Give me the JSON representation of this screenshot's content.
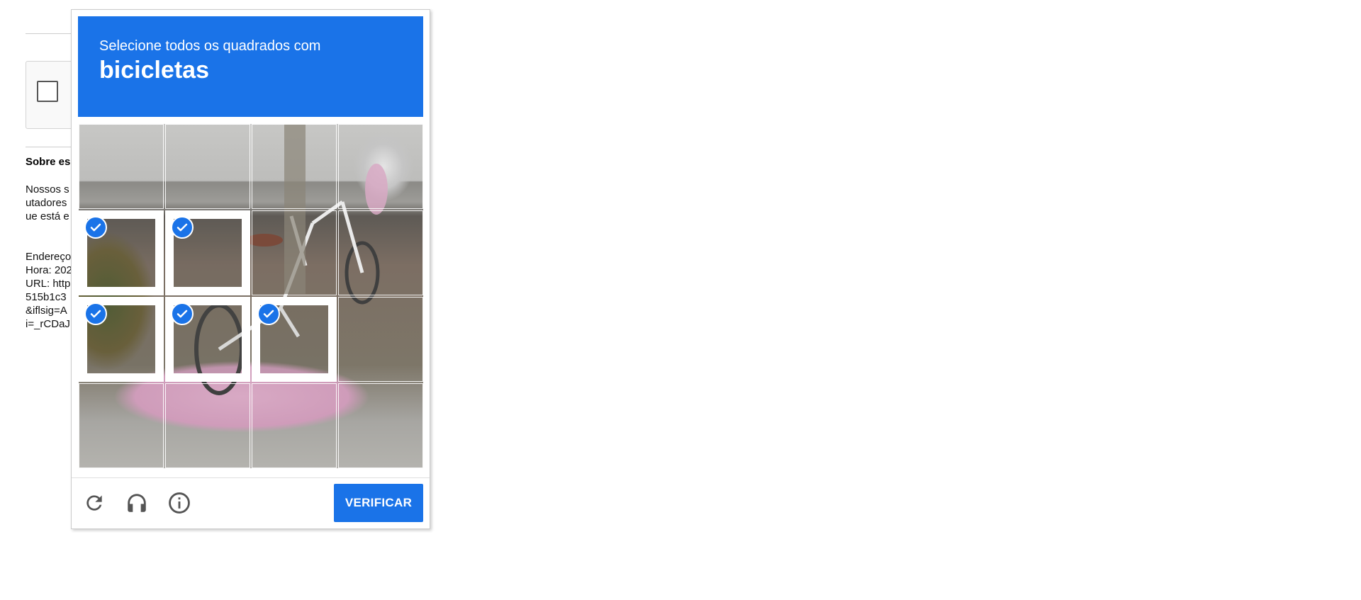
{
  "background_page": {
    "about_title": "Sobre es",
    "paragraph_lines": [
      "Nossos s",
      "utadores",
      "ue está e"
    ],
    "details_lines": [
      "Endereço",
      "Hora: 202",
      "URL: http",
      "515b1c3",
      "&iflsig=A",
      "i=_rCDaJ"
    ]
  },
  "challenge": {
    "instruction": "Selecione todos os quadrados com",
    "object": "bicicletas",
    "selected_tiles": [
      5,
      6,
      9,
      10,
      11
    ],
    "grid_rows": 4,
    "grid_cols": 4
  },
  "footer": {
    "reload_icon": "reload-icon",
    "audio_icon": "headphones-icon",
    "info_icon": "info-icon",
    "verify_label": "VERIFICAR"
  },
  "colors": {
    "accent": "#1a73e8",
    "icon_gray": "#555555"
  }
}
